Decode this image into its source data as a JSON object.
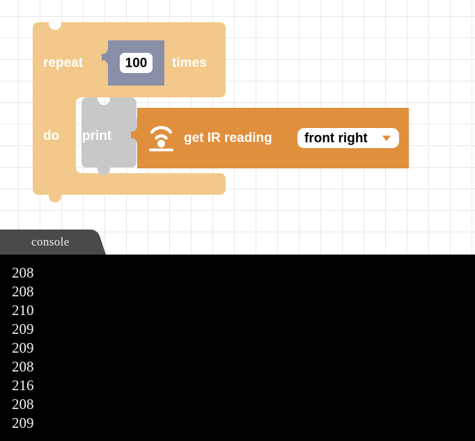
{
  "workspace": {
    "name": "blockly-workspace",
    "grid_color": "#e8e8e8",
    "background_color": "#ffffff",
    "grid_spacing": 31
  },
  "blocks": {
    "repeat": {
      "name": "repeat-block",
      "color": "#f2c98a",
      "label_repeat": "repeat",
      "label_times": "times",
      "label_do": "do",
      "count_field": {
        "name": "repeat-count-field",
        "value": "100",
        "socket_color": "#8a8fa8",
        "field_background": "#ffffff"
      }
    },
    "print": {
      "name": "print-block",
      "color": "#c8c8c8",
      "label": "print"
    },
    "ir_reading": {
      "name": "get-ir-reading-block",
      "color": "#e08f3c",
      "icon": "wifi-signal-icon",
      "label": "get IR reading",
      "dropdown": {
        "name": "ir-sensor-dropdown",
        "value": "front right",
        "arrow": "chevron-down-icon",
        "background": "#ffffff",
        "arrow_color": "#e08f3c"
      }
    }
  },
  "console": {
    "tab": {
      "name": "console-tab",
      "label": "console",
      "color": "#4a4a4a"
    },
    "panel": {
      "name": "console-output",
      "background": "#000000",
      "text_color": "#f2f2f2"
    },
    "lines": [
      "208",
      "208",
      "210",
      "209",
      "209",
      "208",
      "216",
      "208",
      "209"
    ]
  }
}
